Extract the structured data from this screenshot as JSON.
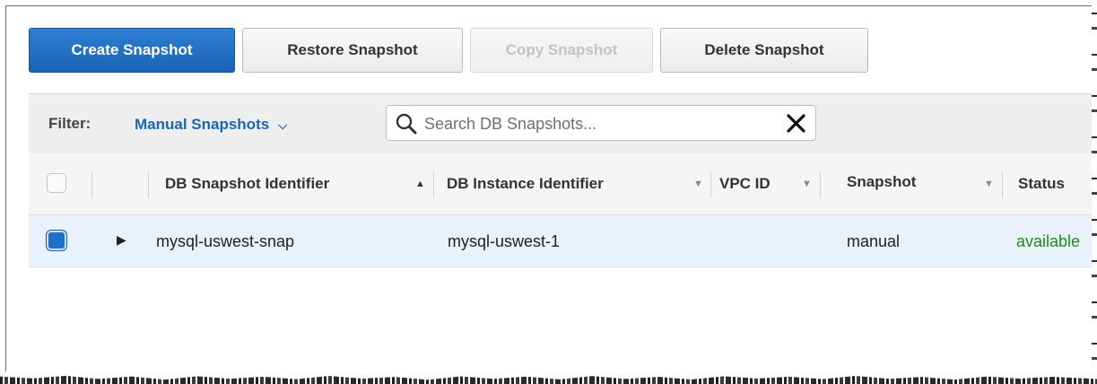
{
  "toolbar": {
    "create_label": "Create Snapshot",
    "restore_label": "Restore Snapshot",
    "copy_label": "Copy Snapshot",
    "delete_label": "Delete Snapshot"
  },
  "filter": {
    "label": "Filter:",
    "selected": "Manual Snapshots",
    "search_placeholder": "Search DB Snapshots...",
    "search_value": ""
  },
  "table": {
    "columns": [
      {
        "label": "DB Snapshot Identifier",
        "sort": "ascending"
      },
      {
        "label": "DB Instance Identifier",
        "sort": "none"
      },
      {
        "label": "VPC ID",
        "sort": "none"
      },
      {
        "label": "Snapshot",
        "sort": "none"
      },
      {
        "label": "Status",
        "sort": "none"
      }
    ],
    "rows": [
      {
        "selected": true,
        "snapshot_id": "mysql-uswest-snap",
        "instance_id": "mysql-uswest-1",
        "vpc_id": "",
        "snapshot_type": "manual",
        "status": "available"
      }
    ]
  },
  "colors": {
    "primary_button": "#1f6fc8",
    "link": "#1b67b7",
    "status_available": "#1d8a18",
    "selected_row": "#e9f2fb"
  },
  "icons": {
    "search": "search-icon",
    "clear": "close-icon",
    "dropdown": "chevron-down-icon",
    "sort": "caret-icon",
    "expand": "caret-right-icon"
  }
}
